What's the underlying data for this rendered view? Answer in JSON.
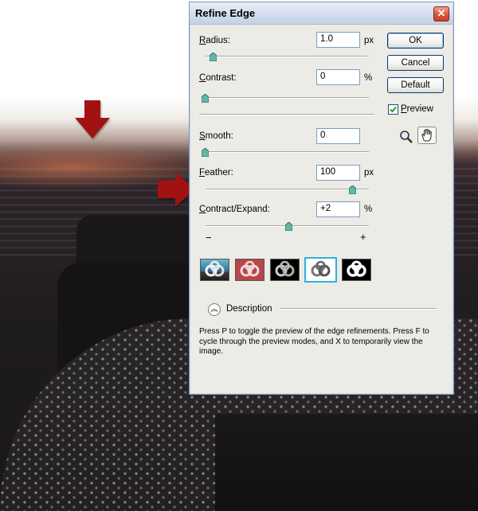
{
  "dialog": {
    "title": "Refine Edge",
    "close_symbol": "✕"
  },
  "controls": {
    "radius": {
      "label_key": "R",
      "label_rest": "adius:",
      "value": "1.0",
      "unit": "px",
      "slider": 0.04
    },
    "contrast": {
      "label_key": "C",
      "label_rest": "ontrast:",
      "value": "0",
      "unit": "%",
      "slider": 0.0
    },
    "smooth": {
      "label_key": "S",
      "label_rest": "mooth:",
      "value": "0",
      "unit": "",
      "slider": 0.0
    },
    "feather": {
      "label_key": "F",
      "label_rest": "eather:",
      "value": "100",
      "unit": "px",
      "slider": 0.95
    },
    "contract_expand": {
      "label_key": "C",
      "label_rest": "ontract/Expand:",
      "value": "+2",
      "unit": "%",
      "slider": 0.51
    },
    "minus": "−",
    "plus": "+"
  },
  "buttons": {
    "ok": "OK",
    "cancel": "Cancel",
    "default": "Default"
  },
  "preview": {
    "label_key": "P",
    "label_rest": "review",
    "checked": true
  },
  "description": {
    "toggle_label": "Description",
    "text": "Press P to toggle the preview of the edge refinements. Press F to cycle through the preview modes, and X to temporarily view the image."
  },
  "colors": {
    "arrow_red": "#a31212",
    "selected_mode_border": "#2fb0e0",
    "slider_thumb": "#5fb9a6"
  }
}
